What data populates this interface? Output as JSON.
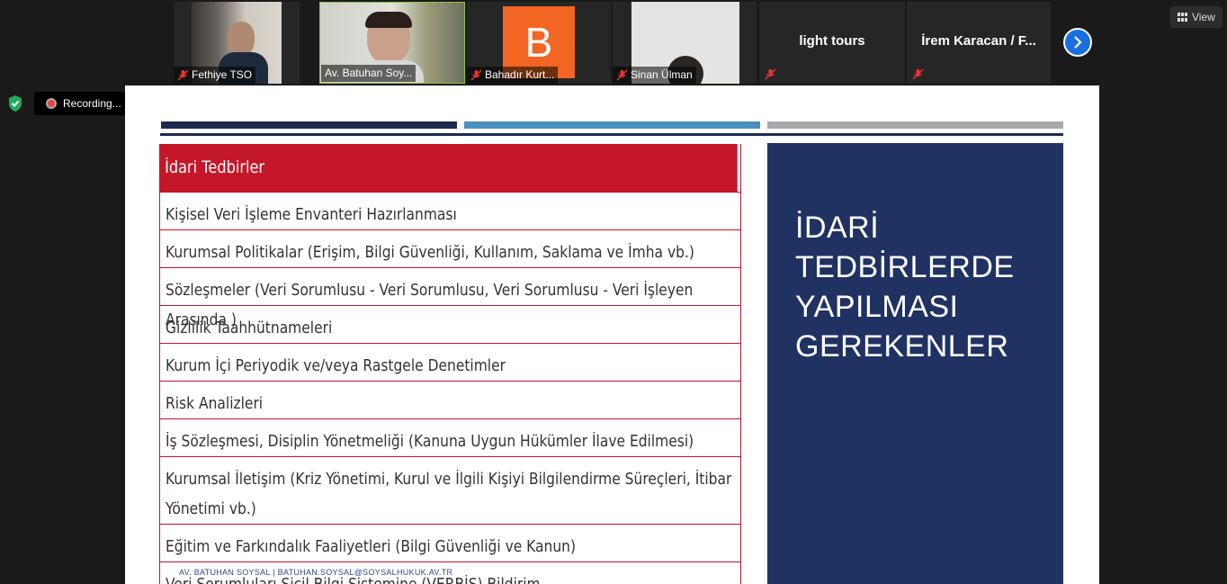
{
  "participants": [
    {
      "name": "Fethiye TSO"
    },
    {
      "name": "Av. Batuhan Soy..."
    },
    {
      "name": "Bahadır Kurt...",
      "initial": "B",
      "color": "#f26522"
    },
    {
      "name": "Sinan Ülman"
    },
    {
      "name": "light tours"
    },
    {
      "name": "İrem Karacan / F..."
    }
  ],
  "view_button": {
    "label": "View",
    "icon": "grid-icon"
  },
  "recording": {
    "label": "Recording..."
  },
  "slide": {
    "table_header": "İdari Tedbirler",
    "rows": [
      "Kişisel Veri İşleme Envanteri Hazırlanması",
      "Kurumsal Politikalar (Erişim, Bilgi Güvenliği, Kullanım, Saklama ve İmha vb.)",
      "Sözleşmeler (Veri Sorumlusu - Veri Sorumlusu, Veri Sorumlusu - Veri İşleyen Arasında )",
      "Gizlilik Taahhütnameleri",
      "Kurum İçi Periyodik ve/veya Rastgele Denetimler",
      "Risk Analizleri",
      "İş Sözleşmesi, Disiplin Yönetmeliği (Kanuna Uygun Hükümler İlave Edilmesi)",
      "Kurumsal İletişim (Kriz Yönetimi, Kurul ve İlgili Kişiyi Bilgilendirme Süreçleri, İtibar Yönetimi vb.)",
      "Eğitim ve Farkındalık Faaliyetleri (Bilgi Güvenliği ve Kanun)",
      "Veri Sorumluları Sicil Bilgi Sistemine (VERBİS) Bildirim"
    ],
    "side_title": [
      "İDARİ",
      "TEDBİRLERDE",
      "YAPILMASI",
      "GEREKENLER"
    ],
    "footer": "AV. BATUHAN SOYSAL | BATUHAN.SOYSAL@SOYSALHUKUK.AV.TR",
    "colors": {
      "red": "#c5172a",
      "navy": "#1f3261",
      "blue": "#4a8fc0",
      "gray": "#a8a9ad"
    }
  }
}
